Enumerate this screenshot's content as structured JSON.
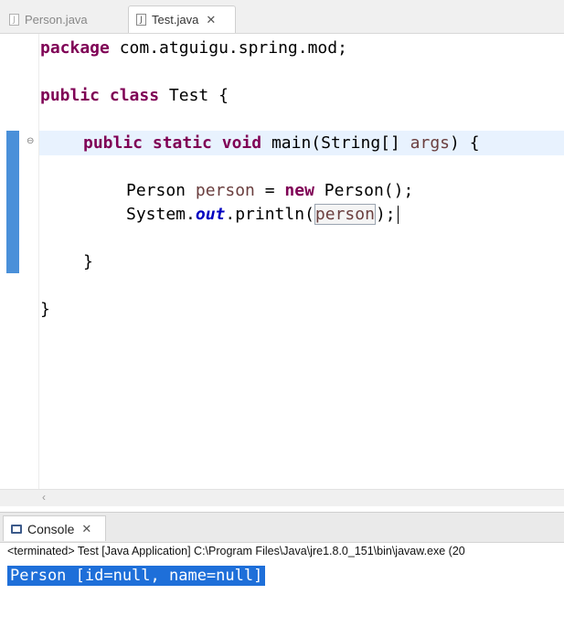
{
  "tabs": [
    {
      "label": "Person.java",
      "icon": "java-file-icon",
      "active": false
    },
    {
      "label": "Test.java",
      "icon": "java-file-icon",
      "active": true,
      "close": "✕"
    }
  ],
  "code": {
    "line1": {
      "kw": "package",
      "rest": " com.atguigu.spring.mod;"
    },
    "line2": {
      "kw1": "public",
      "kw2": "class",
      "rest": " Test {"
    },
    "line3": {
      "kw1": "public",
      "kw2": "static",
      "kw3": "void",
      "mid": " main(String[] ",
      "arg": "args",
      "end": ") {"
    },
    "line4": {
      "type": "Person ",
      "var": "person",
      "eq": " = ",
      "kw": "new",
      "rest": " Person();"
    },
    "line5": {
      "prefix": "System.",
      "field": "out",
      "mid": ".println(",
      "var": "person",
      "end": ");"
    },
    "line6": "}",
    "line7": "}"
  },
  "console": {
    "tab_label": "Console",
    "close": "✕",
    "status": "<terminated> Test [Java Application] C:\\Program Files\\Java\\jre1.8.0_151\\bin\\javaw.exe (20",
    "output": "Person [id=null, name=null]"
  },
  "colors": {
    "keyword": "#7f0055",
    "local_var": "#6a3e3e",
    "static_field": "#0000c0",
    "selection": "#1e6fd9",
    "change_bar": "#4a90d9"
  }
}
